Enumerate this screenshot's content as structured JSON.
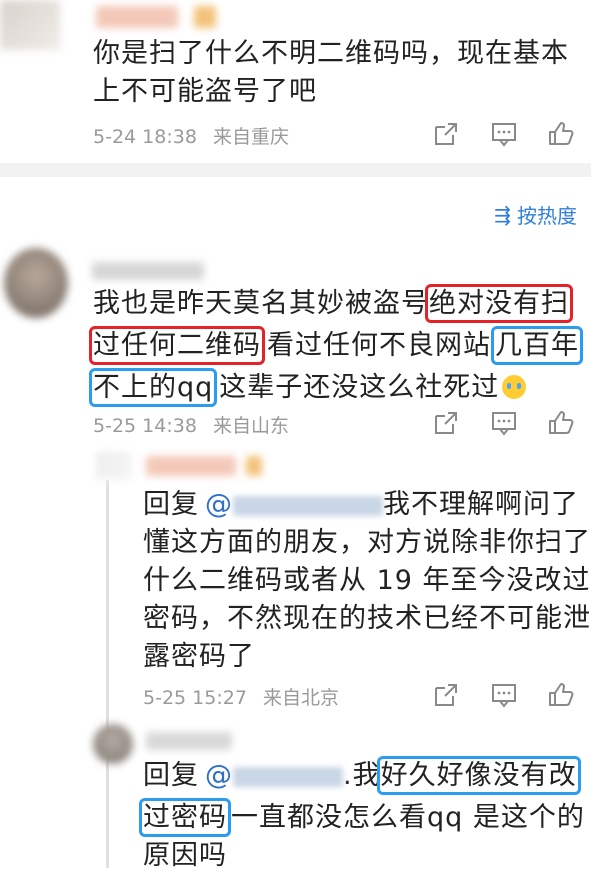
{
  "top_comment": {
    "text_line1": "你是扫了什么不明二维码吗，现在基本",
    "text_line2": "上不可能盗号了吧",
    "time": "5-24 18:38",
    "location": "来自重庆"
  },
  "sort": {
    "label": "按热度"
  },
  "main_comment": {
    "line1_a": "我也是昨天莫名其妙被盗号",
    "line1_red": "绝对没有扫",
    "line2_red": "过任何二维码",
    "line2_b": "看过任何不良网站",
    "line2_blue": "几百年",
    "line3_blue": "不上的qq",
    "line3_b": "这辈子还没这么社死过",
    "time": "5-25 14:38",
    "location": "来自山东"
  },
  "reply1": {
    "prefix": "回复",
    "mention": "@",
    "line1_rest": "我不理解啊问了",
    "line2": "懂这方面的朋友，对方说除非你扫了",
    "line3": "什么二维码或者从 19 年至今没改过",
    "line4": "密码，不然现在的技术已经不可能泄",
    "line5": "露密码了",
    "time": "5-25 15:27",
    "location": "来自北京"
  },
  "reply2": {
    "prefix": "回复",
    "mention": "@",
    "dot": ".",
    "word_wo": "我",
    "blue1": "好久好像没有改",
    "blue2": "过密码",
    "line2_rest": "一直都没怎么看qq 是这个的",
    "line3": "原因吗"
  },
  "icons": [
    "share-icon",
    "comment-icon",
    "like-icon",
    "sort-icon",
    "crying-emoji-icon"
  ]
}
